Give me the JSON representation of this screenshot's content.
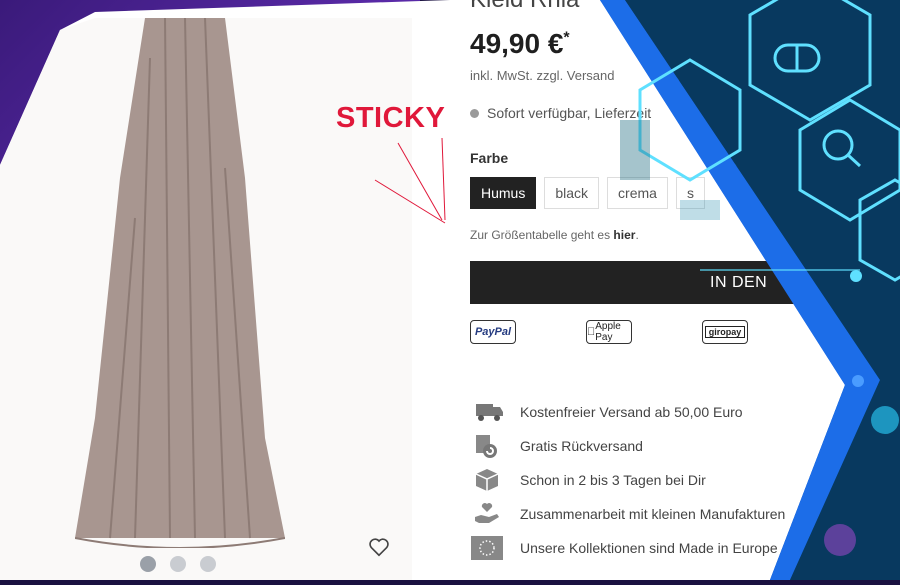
{
  "product": {
    "title_partial": "Kleid Rhia",
    "price": "49,90 €",
    "price_marker": "*",
    "tax_note": "inkl. MwSt. zzgl. Versand",
    "availability": "Sofort verfügbar, Lieferzeit",
    "color_label": "Farbe",
    "colors": [
      "Humus",
      "black",
      "crema",
      "s"
    ],
    "selected_color": "Humus",
    "size_chart_text": "Zur Größentabelle geht es ",
    "size_chart_link": "hier",
    "size_chart_suffix": ".",
    "cart_button": "IN DEN"
  },
  "annotation": {
    "label": "STICKY",
    "color": "#e0183a"
  },
  "payment_methods": [
    "PayPal",
    "Apple Pay",
    "giropay"
  ],
  "features": [
    {
      "icon": "truck-icon",
      "text": "Kostenfreier Versand ab 50,00 Euro"
    },
    {
      "icon": "return-box-icon",
      "text": "Gratis Rückversand"
    },
    {
      "icon": "package-icon",
      "text": "Schon in 2 bis 3 Tagen bei Dir"
    },
    {
      "icon": "hand-heart-icon",
      "text": "Zusammenarbeit mit kleinen Manufakturen"
    },
    {
      "icon": "eu-flag-icon",
      "text": "Unsere Kollektionen sind Made in Europe"
    }
  ],
  "gallery": {
    "dots": 3,
    "active_dot": 1
  },
  "colors": {
    "accent_blue": "#1c6de8",
    "dark_button": "#222222",
    "sticky_red": "#e0183a",
    "tech_cyan": "#5fe0ff"
  }
}
